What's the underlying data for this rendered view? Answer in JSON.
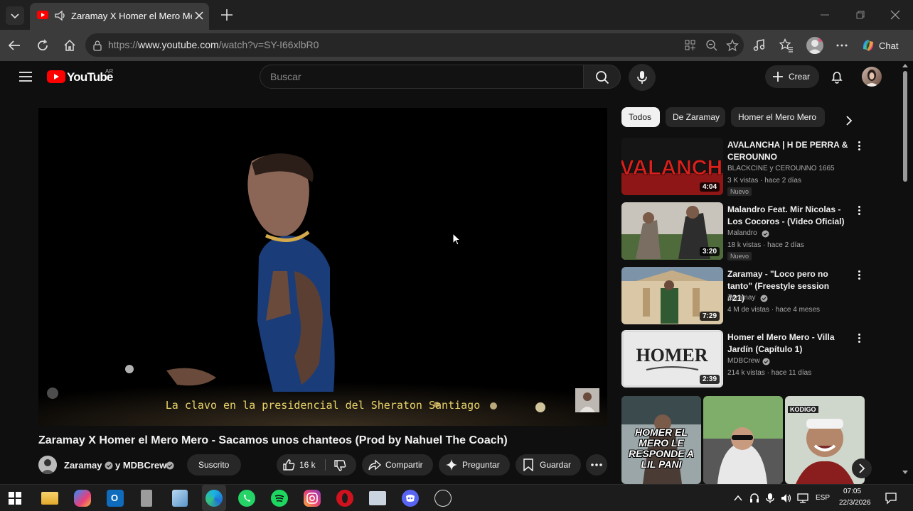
{
  "browser": {
    "tab_title": "Zaramay X Homer el Mero Mero - Sacamos unos chanteos",
    "url_prefix": "https://",
    "url_domain": "www.youtube.com",
    "url_path": "/watch?v=SY-I66xlbR0",
    "chat_label": "Chat"
  },
  "youtube": {
    "logo_text": "YouTube",
    "country_code": "AR",
    "search_placeholder": "Buscar",
    "create_label": "Crear",
    "player": {
      "subtitle": "La clavo en la presidencial del Sheraton Santiago"
    },
    "video": {
      "title": "Zaramay X Homer el Mero Mero - Sacamos unos chanteos (Prod by Nahuel The Coach)",
      "channel": "Zaramay",
      "collab": "y MDBCrew",
      "subscribed_label": "Suscrito",
      "likes": "16 k",
      "share_label": "Compartir",
      "ask_label": "Preguntar",
      "save_label": "Guardar"
    },
    "chips": [
      "Todos",
      "De Zaramay",
      "Homer el Mero Mero"
    ],
    "recommendations": [
      {
        "title": "AVALANCHA | H DE PERRA & CEROUNNO",
        "channel": "BLACKCINE y CEROUNNO 1665",
        "meta": "3 K vistas · hace 2 días",
        "badge": "Nuevo",
        "duration": "4:04",
        "thumb_text": "AVALANCHA"
      },
      {
        "title": "Malandro Feat. Mir Nicolas - Los Cocoros - (Video Oficial)",
        "channel": "Malandro",
        "meta": "18 k vistas · hace 2 días",
        "badge": "Nuevo",
        "duration": "3:20"
      },
      {
        "title": "Zaramay - \"Loco pero no tanto\" (Freestyle session #21)",
        "channel": "Zaramay",
        "meta": "4 M de vistas · hace 4 meses",
        "duration": "7:29"
      },
      {
        "title": "Homer el Mero Mero - Villa Jardín (Capítulo 1)",
        "channel": "MDBCrew",
        "meta": "214 k vistas · hace 11 días",
        "duration": "2:39",
        "thumb_text": "HOMER"
      }
    ],
    "shorts": [
      {
        "caption": "HOMER EL MERO LE RESPONDE A LIL PANI"
      },
      {
        "caption": ""
      },
      {
        "caption": "KODIGO"
      }
    ]
  },
  "taskbar": {
    "language": "ESP",
    "time": "07:05",
    "date": "22/3/2026"
  }
}
